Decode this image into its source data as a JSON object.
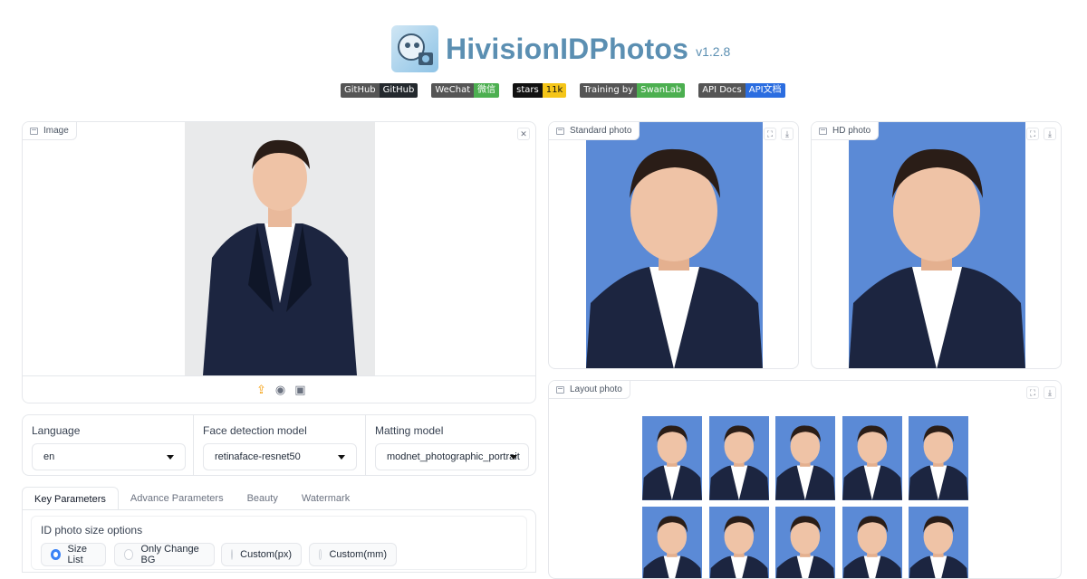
{
  "header": {
    "title": "HivisionIDPhotos",
    "version": "v1.2.8",
    "badges": [
      {
        "left": "GitHub",
        "right": "GitHub",
        "color": "#24292e"
      },
      {
        "left": "WeChat",
        "right": "微信",
        "color": "#4caf50"
      },
      {
        "left": "stars",
        "right": "11k",
        "color": "#f5c518"
      },
      {
        "left": "Training by",
        "right": "SwanLab",
        "color": "#4caf50"
      },
      {
        "left": "API Docs",
        "right": "API文档",
        "color": "#2b6de0"
      }
    ]
  },
  "input_panel": {
    "label": "Image"
  },
  "outputs": {
    "standard": {
      "label": "Standard photo"
    },
    "hd": {
      "label": "HD photo"
    },
    "layout": {
      "label": "Layout photo"
    }
  },
  "settings": {
    "language": {
      "label": "Language",
      "value": "en"
    },
    "face_model": {
      "label": "Face detection model",
      "value": "retinaface-resnet50"
    },
    "matting_model": {
      "label": "Matting model",
      "value": "modnet_photographic_portrait"
    }
  },
  "tabs": [
    "Key Parameters",
    "Advance Parameters",
    "Beauty",
    "Watermark"
  ],
  "size_options": {
    "label": "ID photo size options",
    "options": [
      "Size List",
      "Only Change BG",
      "Custom(px)",
      "Custom(mm)"
    ],
    "selected": "Size List"
  },
  "colors": {
    "photo_bg": "#5b8ad6",
    "accent": "#3b82f6",
    "title": "#5b8fb2"
  }
}
